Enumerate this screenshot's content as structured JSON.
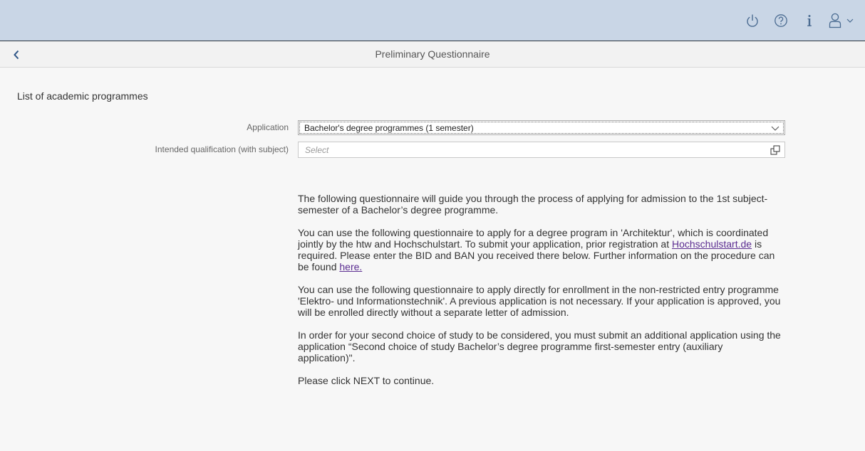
{
  "shell": {
    "icons": [
      "power-icon",
      "help-icon",
      "info-icon",
      "user-icon",
      "chevron-down-icon"
    ],
    "icon_color": "#4a6b91",
    "background": "#c9d6e6"
  },
  "header": {
    "title": "Preliminary Questionnaire"
  },
  "section": {
    "title": "List of academic programmes"
  },
  "form": {
    "application_label": "Application",
    "application_value": "Bachelor's degree programmes (1 semester)",
    "qualification_label": "Intended qualification (with subject)",
    "qualification_placeholder": "Select"
  },
  "content": {
    "p1": "The following questionnaire will guide you through the process of applying for admission to the 1st subject-semester of a Bachelor’s degree programme.",
    "p2_before": "You can use the following questionnaire to apply for a degree program in 'Architektur', which is coordinated jointly by the htw and Hochschulstart. To submit your application, prior registration at ",
    "p2_link1": "Hochschulstart.de",
    "p2_middle": " is required. Please enter the BID and BAN you received there below. Further information on the procedure can be found ",
    "p2_link2": "here.",
    "p3": "You can use the following questionnaire to apply directly for enrollment in the non-restricted entry programme 'Elektro- und Informationstechnik'. A previous application is not necessary. If your application is approved, you will be enrolled directly without a separate letter of admission.",
    "p4": "In order for your second choice of study to be considered, you must submit an additional application using the application “Second choice of study Bachelor’s degree programme first-semester entry (auxiliary application)\".",
    "p5": "Please click NEXT to continue."
  },
  "colors": {
    "link": "#5b2d91",
    "accent": "#4a6b91"
  }
}
